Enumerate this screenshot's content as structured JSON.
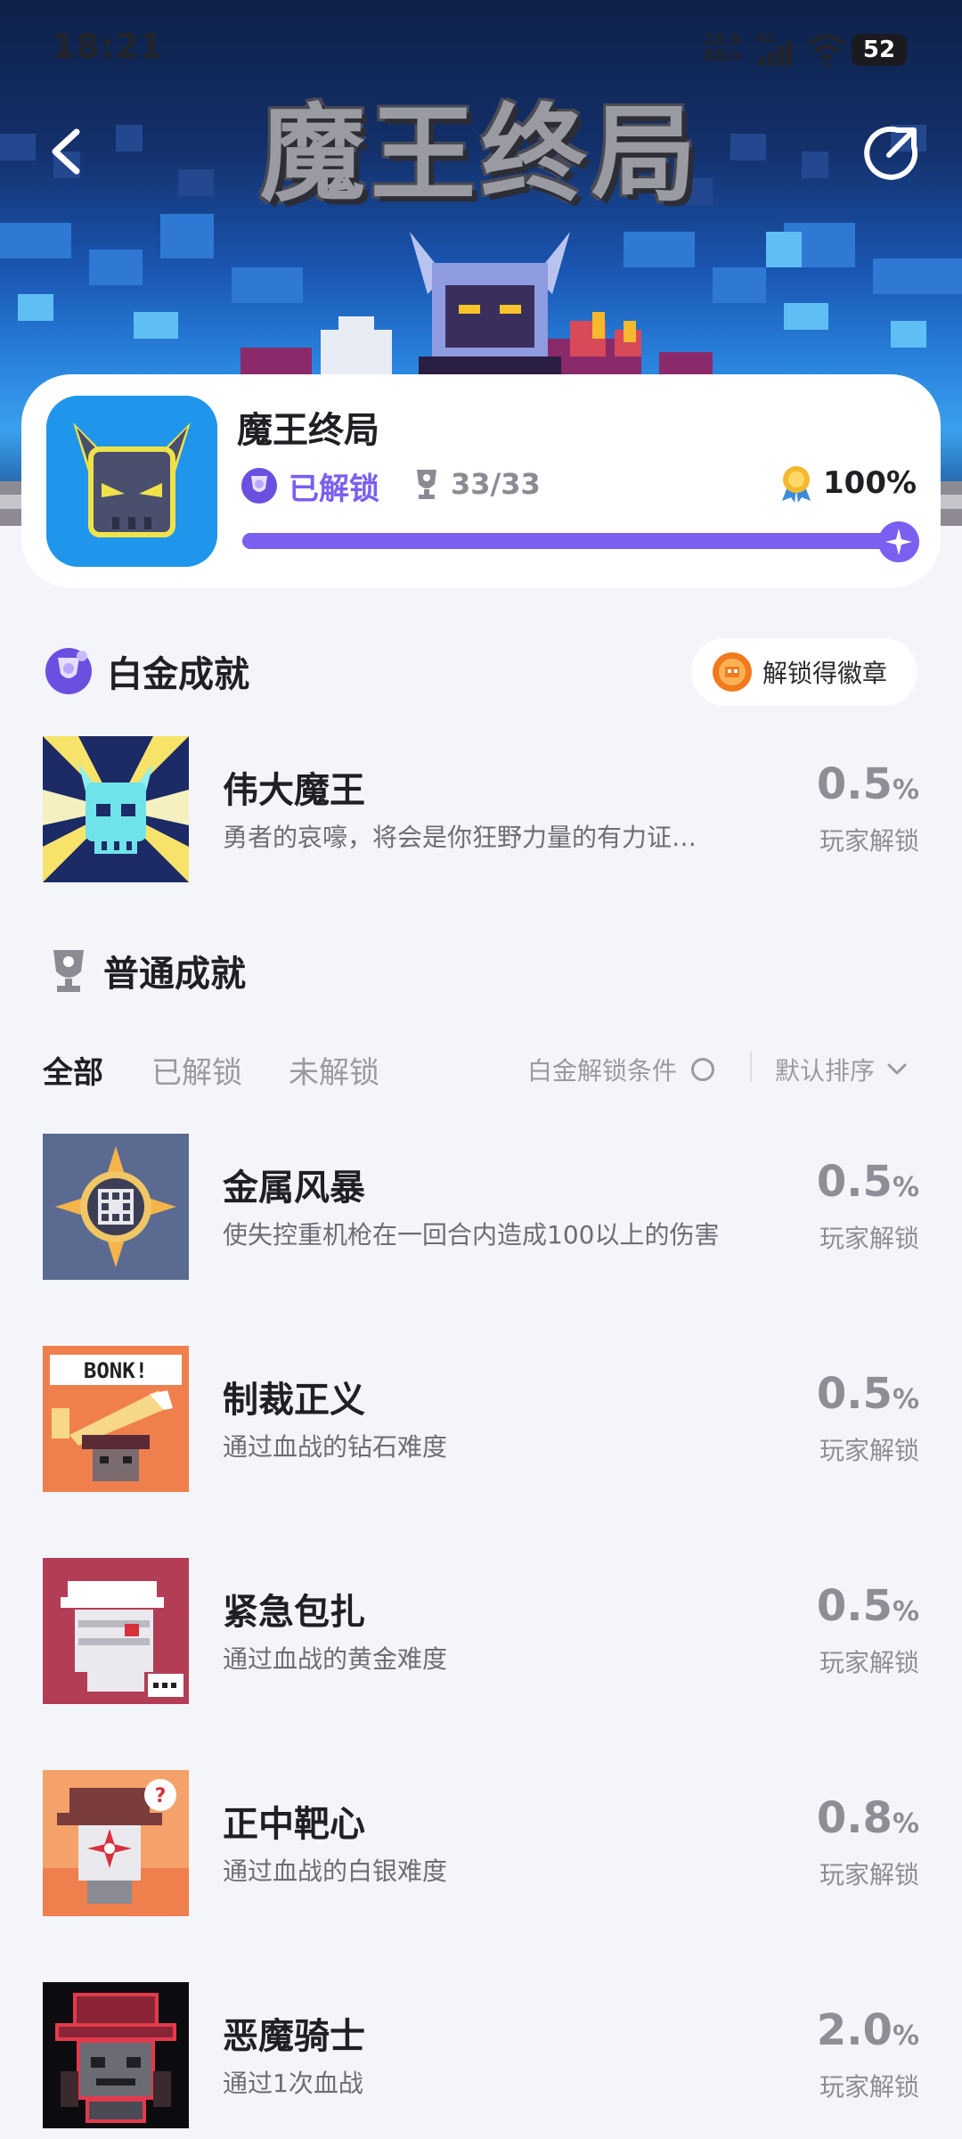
{
  "status_bar": {
    "time": "18:21",
    "net_speed_value": "28.9",
    "net_speed_unit": "KB/s",
    "signal_label": "4G",
    "battery": "52"
  },
  "banner": {
    "logo_text": "魔王终局"
  },
  "game": {
    "title": "魔王终局",
    "unlock_status": "已解锁",
    "trophy_count": "33/33",
    "completion_percent": "100%",
    "progress_fraction": 1.0
  },
  "platinum": {
    "section_title": "白金成就",
    "badge_button_label": "解锁得徽章",
    "achievement": {
      "name": "伟大魔王",
      "description": "勇者的哀嚎，将会是你狂野力量的有力证…",
      "rate": "0.5",
      "rate_unit": "%",
      "rate_label": "玩家解锁"
    }
  },
  "normal": {
    "section_title": "普通成就",
    "tabs": [
      {
        "label": "全部"
      },
      {
        "label": "已解锁"
      },
      {
        "label": "未解锁"
      }
    ],
    "platinum_condition_label": "白金解锁条件",
    "sort_label": "默认排序",
    "achievements": [
      {
        "name": "金属风暴",
        "description": "使失控重机枪在一回合内造成100以上的伤害",
        "rate": "0.5",
        "rate_unit": "%",
        "rate_label": "玩家解锁"
      },
      {
        "name": "制裁正义",
        "description": "通过血战的钻石难度",
        "rate": "0.5",
        "rate_unit": "%",
        "rate_label": "玩家解锁",
        "thumb_text": "BONK!"
      },
      {
        "name": "紧急包扎",
        "description": "通过血战的黄金难度",
        "rate": "0.5",
        "rate_unit": "%",
        "rate_label": "玩家解锁"
      },
      {
        "name": "正中靶心",
        "description": "通过血战的白银难度",
        "rate": "0.8",
        "rate_unit": "%",
        "rate_label": "玩家解锁"
      },
      {
        "name": "恶魔骑士",
        "description": "通过1次血战",
        "rate": "2.0",
        "rate_unit": "%",
        "rate_label": "玩家解锁"
      }
    ]
  },
  "colors": {
    "accent": "#7a5ff0",
    "background": "#f4f5f8",
    "muted_text": "#8e8e96"
  }
}
